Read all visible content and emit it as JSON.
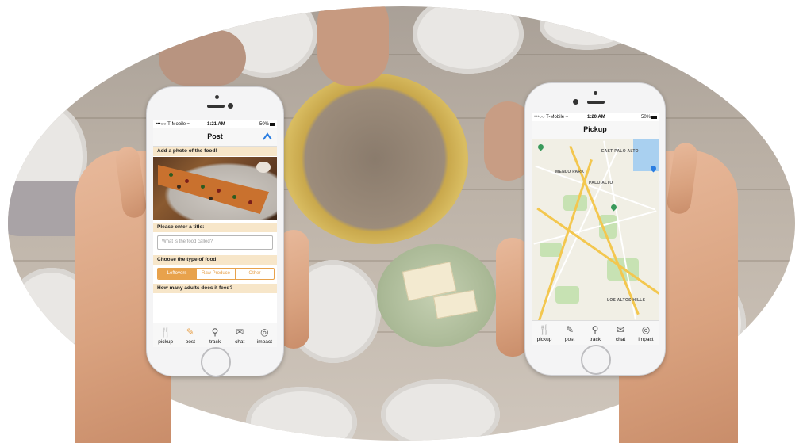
{
  "left_phone": {
    "status": {
      "carrier": "•••○○ T-Mobile ≈",
      "time": "1:21 AM",
      "battery": "50%"
    },
    "nav": {
      "title": "Post",
      "action_icon": "chevron-up-icon"
    },
    "photo_section": {
      "label": "Add a photo of the food!"
    },
    "title_section": {
      "label": "Please enter a title:",
      "placeholder": "What is the food called?"
    },
    "type_section": {
      "label": "Choose the type of food:",
      "options": [
        "Leftovers",
        "Raw Produce",
        "Other"
      ],
      "selected": "Leftovers"
    },
    "adults_section": {
      "label": "How many adults does it feed?"
    },
    "tabs": [
      {
        "label": "pickup",
        "icon": "fork-knife-icon"
      },
      {
        "label": "post",
        "icon": "pencil-icon"
      },
      {
        "label": "track",
        "icon": "location-pin-icon"
      },
      {
        "label": "chat",
        "icon": "envelope-icon"
      },
      {
        "label": "impact",
        "icon": "target-icon"
      }
    ],
    "active_tab": "post"
  },
  "right_phone": {
    "status": {
      "carrier": "•••○○ T-Mobile ≈",
      "time": "1:20 AM",
      "battery": "50%"
    },
    "nav": {
      "title": "Pickup"
    },
    "map_labels": {
      "east_palo_alto": "EAST PALO ALTO",
      "menlo_park": "MENLO PARK",
      "palo_alto": "PALO ALTO",
      "los_altos": "LOS ALTOS HILLS"
    },
    "tabs": [
      {
        "label": "pickup",
        "icon": "fork-knife-icon"
      },
      {
        "label": "post",
        "icon": "pencil-icon"
      },
      {
        "label": "track",
        "icon": "location-pin-icon"
      },
      {
        "label": "chat",
        "icon": "envelope-icon"
      },
      {
        "label": "impact",
        "icon": "target-icon"
      }
    ],
    "active_tab": "pickup"
  },
  "colors": {
    "accent": "#e8a24c",
    "section_bg": "#f7e6c9",
    "nav_icon": "#2a7de1"
  }
}
